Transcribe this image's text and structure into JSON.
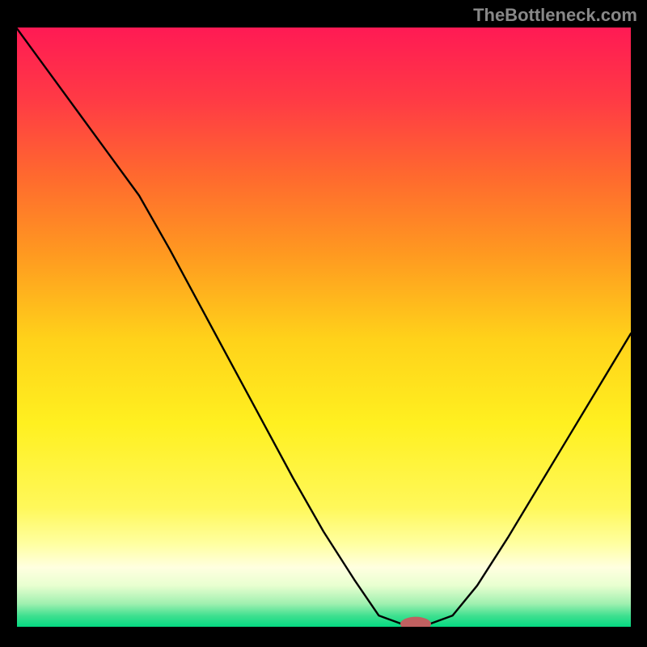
{
  "watermark": "TheBottleneck.com",
  "chart_data": {
    "type": "line",
    "title": "",
    "xlabel": "",
    "ylabel": "",
    "xlim": [
      0,
      100
    ],
    "ylim": [
      0,
      100
    ],
    "x": [
      0,
      5,
      10,
      15,
      20,
      25,
      30,
      35,
      40,
      45,
      50,
      55,
      59,
      63,
      67,
      71,
      75,
      80,
      85,
      90,
      95,
      100
    ],
    "y": [
      100,
      93,
      86,
      79,
      72,
      63,
      53.5,
      44,
      34.5,
      25,
      16,
      8,
      2,
      0.5,
      0.5,
      2,
      7,
      15,
      23.5,
      32,
      40.5,
      49
    ],
    "marker": {
      "x": 65,
      "y": 0.6,
      "color": "#c06060",
      "rx": 2.5,
      "ry": 1.2
    },
    "gradient_stops": [
      {
        "offset": 0,
        "color": "#ff1a54"
      },
      {
        "offset": 12,
        "color": "#ff3a45"
      },
      {
        "offset": 25,
        "color": "#ff6a2e"
      },
      {
        "offset": 38,
        "color": "#ff9a20"
      },
      {
        "offset": 52,
        "color": "#ffd21a"
      },
      {
        "offset": 66,
        "color": "#fff020"
      },
      {
        "offset": 80,
        "color": "#fff85a"
      },
      {
        "offset": 86,
        "color": "#ffffa0"
      },
      {
        "offset": 90,
        "color": "#ffffe0"
      },
      {
        "offset": 93,
        "color": "#e8ffd0"
      },
      {
        "offset": 96,
        "color": "#a0f0b0"
      },
      {
        "offset": 98,
        "color": "#40e090"
      },
      {
        "offset": 100,
        "color": "#00d880"
      }
    ]
  }
}
